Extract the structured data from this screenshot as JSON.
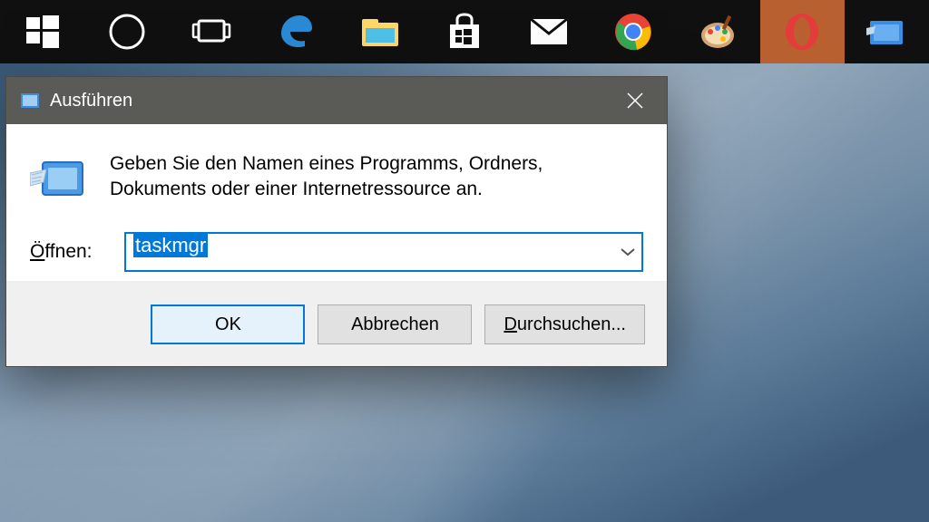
{
  "taskbar": {
    "items": [
      {
        "name": "start-icon"
      },
      {
        "name": "cortana-icon"
      },
      {
        "name": "taskview-icon"
      },
      {
        "name": "edge-icon"
      },
      {
        "name": "explorer-icon"
      },
      {
        "name": "store-icon"
      },
      {
        "name": "mail-icon"
      },
      {
        "name": "chrome-icon"
      },
      {
        "name": "paint-icon"
      },
      {
        "name": "opera-icon",
        "active": true
      },
      {
        "name": "run-icon"
      }
    ]
  },
  "runDialog": {
    "title": "Ausführen",
    "instruction": "Geben Sie den Namen eines Programms, Ordners, Dokuments oder einer Internetressource an.",
    "openLabel": "Öffnen:",
    "openLabelMnemonic": "Ö",
    "inputValue": "taskmgr",
    "buttons": {
      "ok": "OK",
      "cancel": "Abbrechen",
      "browse": "Durchsuchen...",
      "browseMnemonic": "D"
    }
  }
}
